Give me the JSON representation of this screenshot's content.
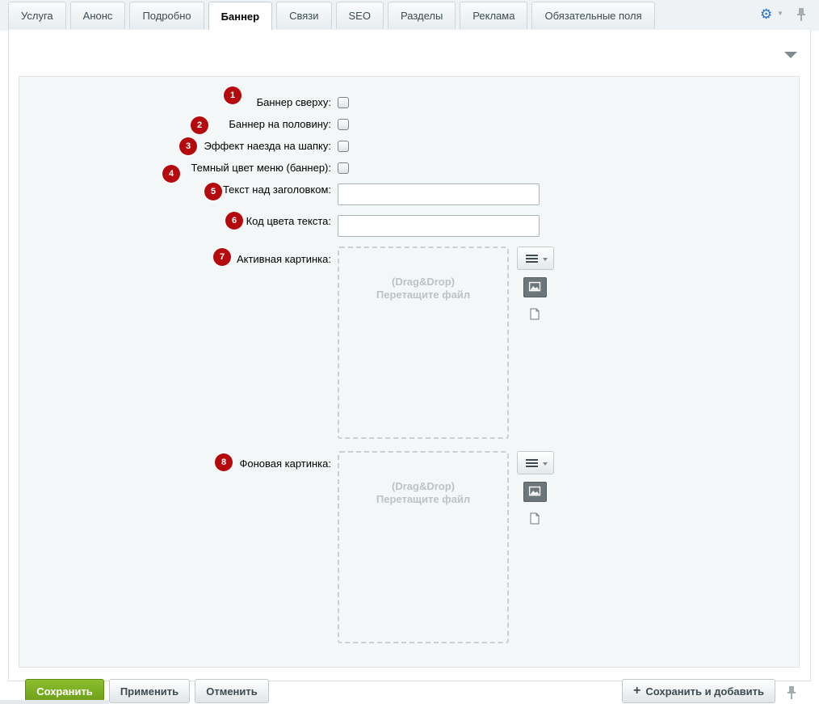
{
  "tabs": [
    {
      "label": "Услуга"
    },
    {
      "label": "Анонс"
    },
    {
      "label": "Подробно"
    },
    {
      "label": "Баннер",
      "active": true
    },
    {
      "label": "Связи"
    },
    {
      "label": "SEO"
    },
    {
      "label": "Разделы"
    },
    {
      "label": "Реклама"
    },
    {
      "label": "Обязательные поля"
    }
  ],
  "icons": {
    "settings": "gear-icon",
    "pin": "pin-icon",
    "collapse": "triangle-down-icon",
    "menu": "hamburger-icon",
    "image": "image-icon",
    "file": "file-icon",
    "plus": "plus-icon"
  },
  "fields": [
    {
      "badge": "1",
      "label": "Баннер сверху:",
      "type": "checkbox",
      "checked": false
    },
    {
      "badge": "2",
      "label": "Баннер на половину:",
      "type": "checkbox",
      "checked": false
    },
    {
      "badge": "3",
      "label": "Эффект наезда на шапку:",
      "type": "checkbox",
      "checked": false
    },
    {
      "badge": "4",
      "label": "Темный цвет меню (баннер):",
      "type": "checkbox",
      "checked": false
    },
    {
      "badge": "5",
      "label": "Текст над заголовком:",
      "type": "text",
      "value": ""
    },
    {
      "badge": "6",
      "label": "Код цвета текста:",
      "type": "text",
      "value": ""
    },
    {
      "badge": "7",
      "label": "Активная картинка:",
      "type": "file"
    },
    {
      "badge": "8",
      "label": "Фоновая картинка:",
      "type": "file"
    }
  ],
  "dropzone": {
    "line1": "(Drag&Drop)",
    "line2": "Перетащите файл"
  },
  "buttons": {
    "save": "Сохранить",
    "apply": "Применить",
    "cancel": "Отменить",
    "save_add": "Сохранить и добавить"
  },
  "colors": {
    "save_button": "#7aad20",
    "badge": "#b5090e",
    "active_tab": "#ffffff",
    "gear": "#2b72c7"
  }
}
